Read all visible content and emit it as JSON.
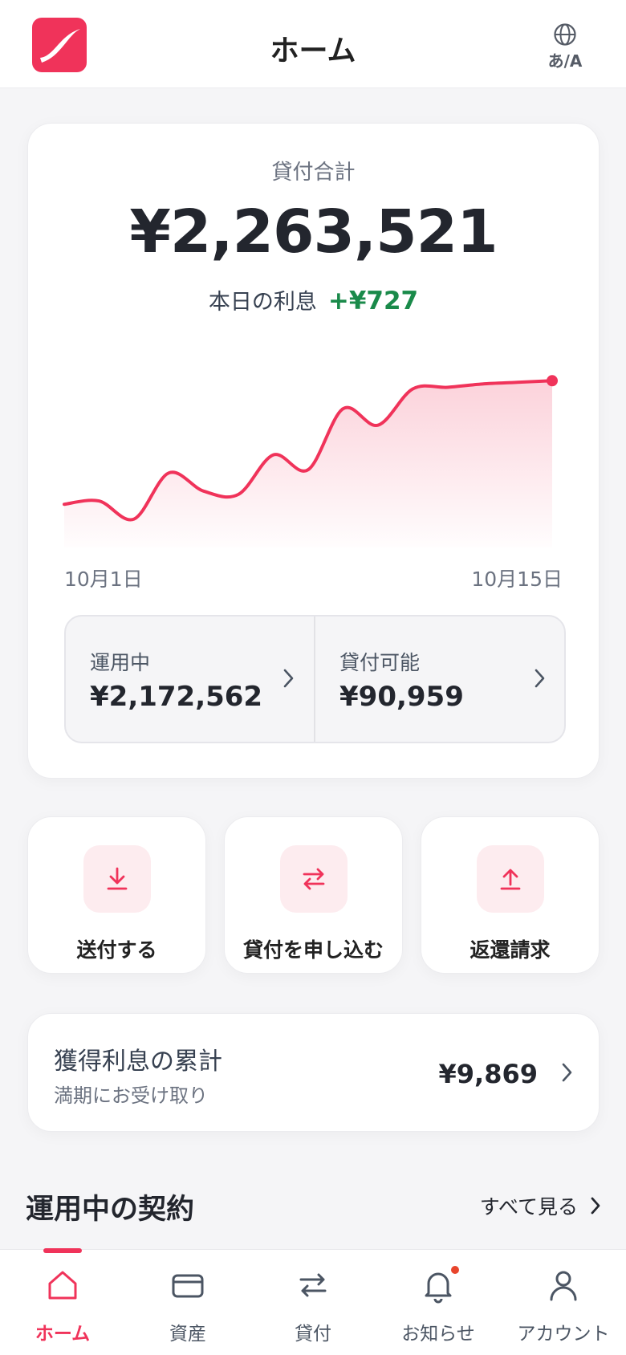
{
  "header": {
    "title": "ホーム",
    "language_label": "あ/A"
  },
  "summary": {
    "total_label": "貸付合計",
    "total_value": "¥2,263,521",
    "today_label": "本日の利息",
    "today_value": "+¥727",
    "date_start": "10月1日",
    "date_end": "10月15日",
    "operating_label": "運用中",
    "operating_value": "¥2,172,562",
    "available_label": "貸付可能",
    "available_value": "¥90,959"
  },
  "chart_data": {
    "type": "area",
    "x": [
      "10月1日",
      "",
      "",
      "",
      "",
      "",
      "",
      "",
      "",
      "",
      "",
      "",
      "",
      "",
      "10月15日"
    ],
    "values": [
      2.5,
      2.7,
      1.6,
      4.4,
      3.3,
      3.1,
      5.5,
      4.6,
      8.3,
      7.3,
      9.5,
      9.6,
      9.8,
      9.9,
      10.0
    ],
    "color": "#f0335a",
    "grid": false,
    "xlabel": "",
    "ylabel": ""
  },
  "actions": [
    {
      "label": "送付する",
      "icon": "download-icon"
    },
    {
      "label": "貸付を申し込む",
      "icon": "swap-arrows-icon"
    },
    {
      "label": "返還請求",
      "icon": "upload-icon"
    }
  ],
  "interest": {
    "title": "獲得利息の累計",
    "subtitle": "満期にお受け取り",
    "value": "¥9,869"
  },
  "contracts": {
    "title": "運用中の契約",
    "see_all": "すべて見る"
  },
  "tabs": [
    {
      "label": "ホーム",
      "icon": "home-icon",
      "active": true
    },
    {
      "label": "資産",
      "icon": "wallet-icon",
      "active": false
    },
    {
      "label": "貸付",
      "icon": "swap-arrows-icon",
      "active": false
    },
    {
      "label": "お知らせ",
      "icon": "bell-icon",
      "active": false,
      "badge": true
    },
    {
      "label": "アカウント",
      "icon": "user-icon",
      "active": false
    }
  ],
  "colors": {
    "accent": "#f0335a",
    "positive": "#1a8a4a",
    "badge": "#e8452c"
  }
}
